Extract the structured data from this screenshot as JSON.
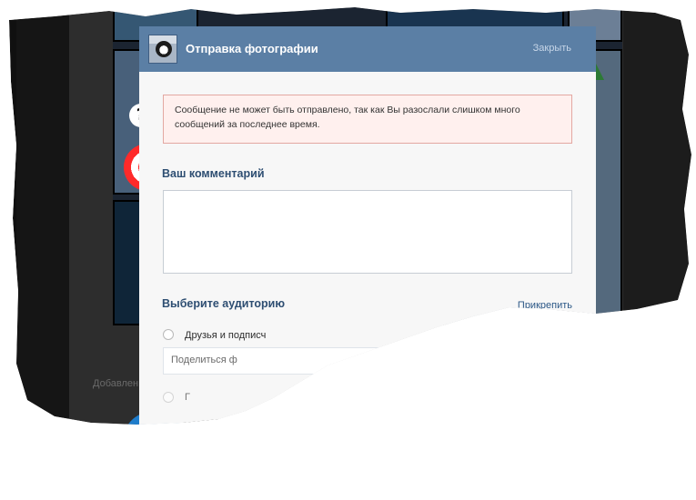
{
  "modal": {
    "title": "Отправка фотографии",
    "close_label": "Закрыть",
    "error_message": "Сообщение не может быть отправлено, так как Вы разослали слишком много сообщений за последнее время.",
    "comment_label": "Ваш комментарий",
    "comment_value": "",
    "audience_label": "Выберите аудиторию",
    "attach_label": "Прикрепить",
    "audience_options": [
      {
        "label": "Друзья и подписч"
      },
      {
        "label": "Поделиться ф"
      },
      {
        "label": "Г"
      }
    ]
  },
  "background": {
    "added_text": "Добавлен"
  },
  "colors": {
    "header": "#5b7fa5",
    "error_bg": "#fff0ee",
    "error_border": "#e3a8a2",
    "label": "#2e4e72",
    "link": "#2b5786"
  }
}
